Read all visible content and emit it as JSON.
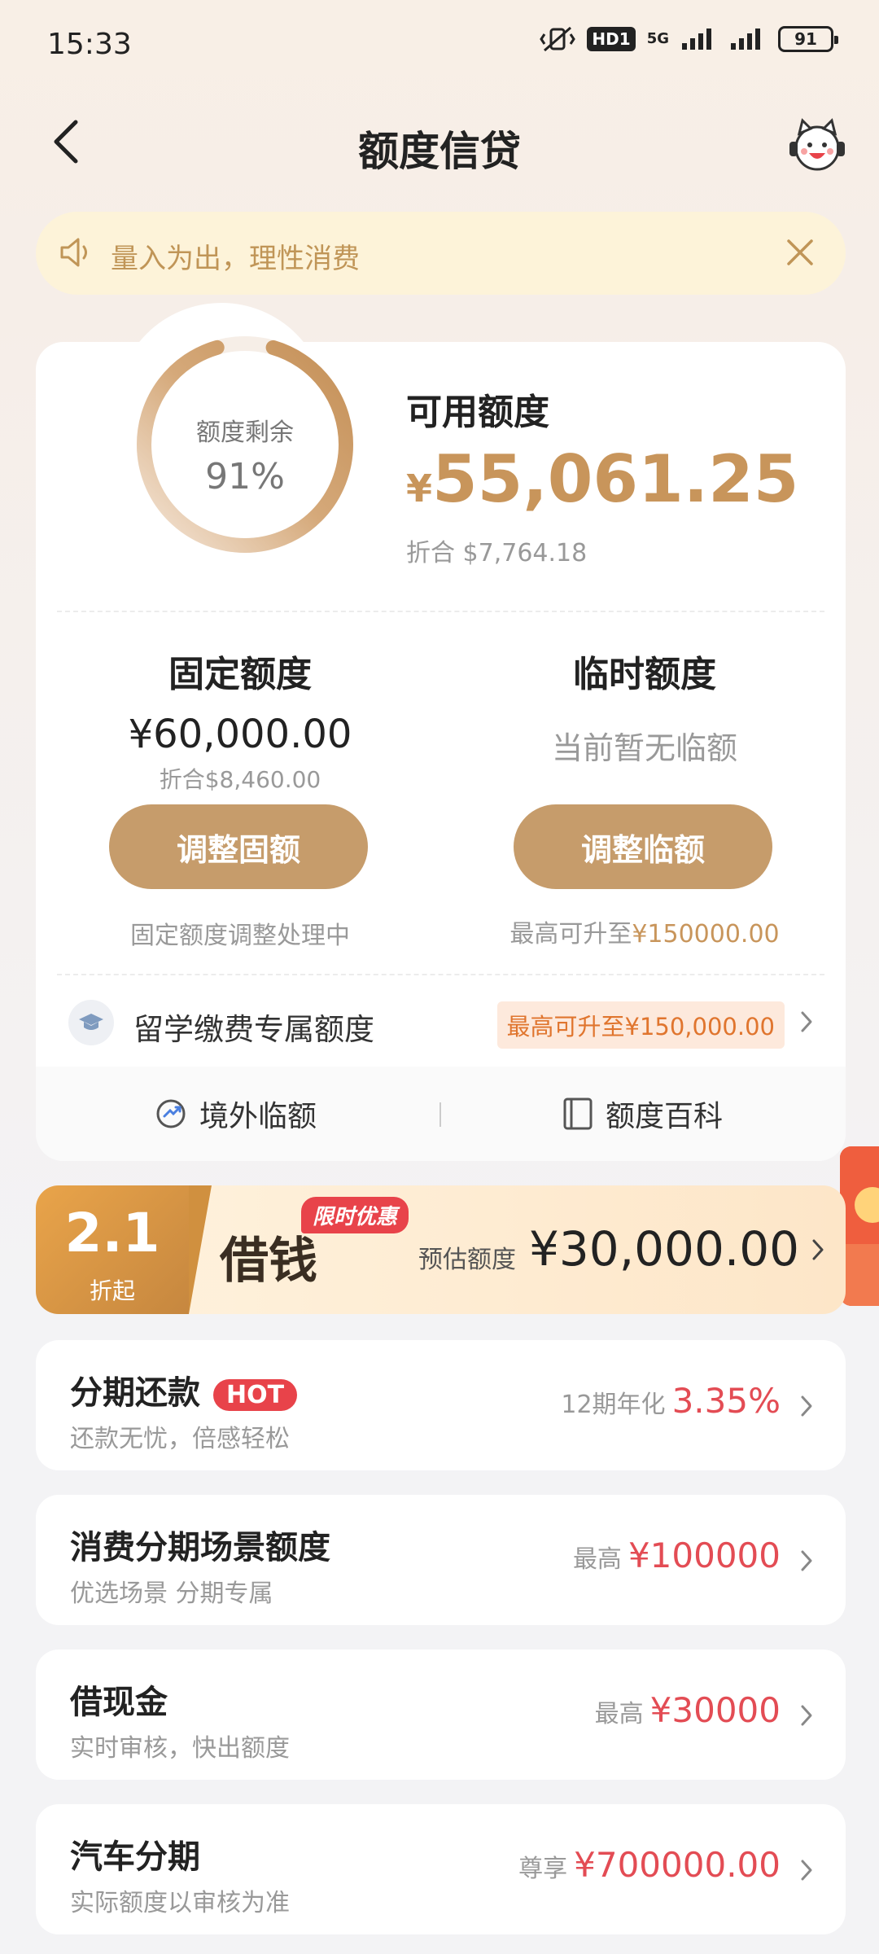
{
  "status_bar": {
    "time": "15:33",
    "hd": "HD1",
    "network": "5G",
    "battery": "91"
  },
  "header": {
    "title": "额度信贷",
    "back_icon": "chevron-left-icon",
    "mascot_icon": "mascot-avatar-icon"
  },
  "notice": {
    "text": "量入为出，理性消费",
    "icon": "speaker-icon",
    "close_icon": "close-icon"
  },
  "credit": {
    "ring_label": "额度剩余",
    "ring_percent_text": "91%",
    "ring_fraction": 0.91,
    "available_label": "可用额度",
    "available_currency": "¥",
    "available_amount": "55,061.25",
    "available_converted": "折合  $7,764.18",
    "fixed": {
      "title": "固定额度",
      "amount": "¥60,000.00",
      "converted": "折合$8,460.00",
      "button": "调整固额",
      "note": "固定额度调整处理中"
    },
    "temporary": {
      "title": "临时额度",
      "status": "当前暂无临额",
      "button": "调整临额",
      "note_prefix": "最高可升至",
      "note_value": "¥150000.00"
    },
    "study": {
      "label": "留学缴费专属额度",
      "badge": "最高可升至¥150,000.00",
      "icon": "graduation-cap-icon"
    },
    "links": {
      "overseas": "境外临额",
      "wiki": "额度百科",
      "overseas_icon": "exchange-icon",
      "wiki_icon": "book-icon"
    }
  },
  "borrow_banner": {
    "rate": "2.1",
    "rate_sub": "折起",
    "title": "借钱",
    "tag": "限时优惠",
    "est_label": "预估额度",
    "est_amount": "¥30,000.00"
  },
  "products": [
    {
      "title": "分期还款",
      "badge": "HOT",
      "sub": "还款无忧，倍感轻松",
      "prefix": "12期年化",
      "value": "3.35%"
    },
    {
      "title": "消费分期场景额度",
      "sub": "优选场景 分期专属",
      "prefix": "最高",
      "value": "¥100000"
    },
    {
      "title": "借现金",
      "sub": "实时审核，快出额度",
      "prefix": "最高",
      "value": "¥30000"
    },
    {
      "title": "汽车分期",
      "sub": "实际额度以审核为准",
      "prefix": "尊享",
      "value": "¥700000.00"
    }
  ],
  "colors": {
    "accent_gold": "#c8955b",
    "button_gold": "#c69c6b",
    "price_red": "#e34c54"
  }
}
